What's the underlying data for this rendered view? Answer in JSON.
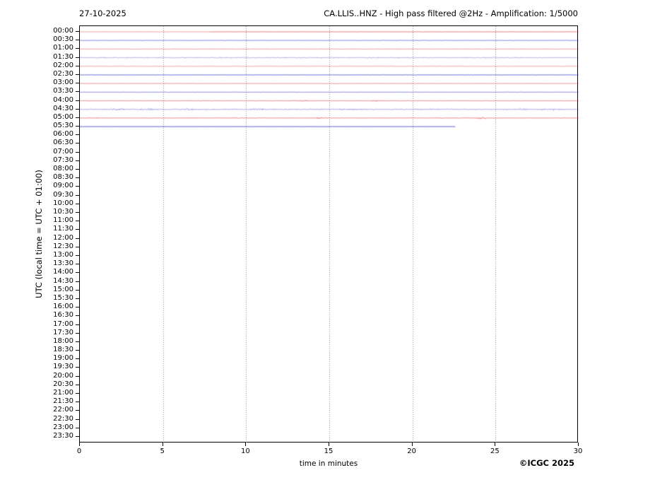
{
  "header": {
    "date": "27-10-2025",
    "title": "CA.LLIS..HNZ - High pass filtered @2Hz - Amplification: 1/5000"
  },
  "footer": {
    "copyright": "©ICGC 2025"
  },
  "chart_data": {
    "type": "line",
    "variant": "helicorder-seismogram",
    "title": "CA.LLIS..HNZ - High pass filtered @2Hz - Amplification: 1/5000",
    "date": "27-10-2025",
    "station": "CA.LLIS..HNZ",
    "filter": "High pass filtered @2Hz",
    "amplification": "1/5000",
    "xlabel": "time in minutes",
    "ylabel": "UTC (local time = UTC + 01:00)",
    "xlim": [
      0,
      30
    ],
    "x_ticks": [
      0,
      5,
      10,
      15,
      20,
      25,
      30
    ],
    "grid": "vertical-dotted",
    "legend": "none",
    "row_labels": [
      "00:00",
      "00:30",
      "01:00",
      "01:30",
      "02:00",
      "02:30",
      "03:00",
      "03:30",
      "04:00",
      "04:30",
      "05:00",
      "05:30",
      "06:00",
      "06:30",
      "07:00",
      "07:30",
      "08:00",
      "08:30",
      "09:00",
      "09:30",
      "10:00",
      "10:30",
      "11:00",
      "11:30",
      "12:00",
      "12:30",
      "13:00",
      "13:30",
      "14:00",
      "14:30",
      "15:00",
      "15:30",
      "16:00",
      "16:30",
      "17:00",
      "17:30",
      "18:00",
      "18:30",
      "19:00",
      "19:30",
      "20:00",
      "20:30",
      "21:00",
      "21:30",
      "22:00",
      "22:30",
      "23:00",
      "23:30"
    ],
    "colors": {
      "red": "#e02828",
      "blue": "#3333cc",
      "grid": "#888888",
      "axes": "#000000"
    },
    "traces": [
      {
        "label": "00:00",
        "color": "red",
        "segments": [
          {
            "s": 0,
            "e": 7.8,
            "amp": 0.15,
            "alpha": 0.4
          },
          {
            "s": 7.8,
            "e": 30,
            "amp": 0.5,
            "alpha": 0.6
          }
        ],
        "events": []
      },
      {
        "label": "00:30",
        "color": "blue",
        "segments": [
          {
            "s": 0,
            "e": 30,
            "amp": 0.5,
            "alpha": 0.6
          }
        ],
        "events": [
          {
            "m": 19.3,
            "a": 0.35,
            "w": 1.6
          }
        ]
      },
      {
        "label": "01:00",
        "color": "red",
        "segments": [
          {
            "s": 0,
            "e": 30,
            "amp": 0.55,
            "alpha": 0.45
          }
        ],
        "events": []
      },
      {
        "label": "01:30",
        "color": "blue",
        "segments": [
          {
            "s": 0,
            "e": 30,
            "amp": 1.2,
            "alpha": 0.35
          }
        ],
        "events": []
      },
      {
        "label": "02:00",
        "color": "red",
        "segments": [
          {
            "s": 0,
            "e": 30,
            "amp": 0.6,
            "alpha": 0.4
          }
        ],
        "events": []
      },
      {
        "label": "02:30",
        "color": "blue",
        "segments": [
          {
            "s": 0,
            "e": 30,
            "amp": 0.45,
            "alpha": 0.7
          }
        ],
        "events": []
      },
      {
        "label": "03:00",
        "color": "red",
        "segments": [
          {
            "s": 0,
            "e": 30,
            "amp": 0.5,
            "alpha": 0.5
          }
        ],
        "events": []
      },
      {
        "label": "03:30",
        "color": "blue",
        "segments": [
          {
            "s": 0,
            "e": 30,
            "amp": 0.55,
            "alpha": 0.55
          }
        ],
        "events": []
      },
      {
        "label": "04:00",
        "color": "red",
        "segments": [
          {
            "s": 0,
            "e": 30,
            "amp": 0.7,
            "alpha": 0.55
          }
        ],
        "events": [
          {
            "m": 13.4,
            "a": 1.1,
            "w": 0.22
          },
          {
            "m": 17.7,
            "a": 1.1,
            "w": 0.22
          }
        ]
      },
      {
        "label": "04:30",
        "color": "blue",
        "segments": [
          {
            "s": 0,
            "e": 30,
            "amp": 1.2,
            "alpha": 0.4
          }
        ],
        "events": [
          {
            "m": 2.4,
            "a": 1.1,
            "w": 0.3
          },
          {
            "m": 4.1,
            "a": 0.9,
            "w": 0.25
          },
          {
            "m": 6.6,
            "a": 1.0,
            "w": 0.3
          },
          {
            "m": 10.7,
            "a": 0.8,
            "w": 0.3
          },
          {
            "m": 16.2,
            "a": 0.7,
            "w": 0.45
          },
          {
            "m": 26.6,
            "a": 1.2,
            "w": 0.2
          },
          {
            "m": 28.5,
            "a": 1.3,
            "w": 0.3
          }
        ]
      },
      {
        "label": "05:00",
        "color": "red",
        "segments": [
          {
            "s": 0,
            "e": 30,
            "amp": 0.6,
            "alpha": 0.55
          }
        ],
        "events": [
          {
            "m": 1.0,
            "a": 0.7,
            "w": 0.2
          },
          {
            "m": 6.7,
            "a": 0.8,
            "w": 0.2
          },
          {
            "m": 9.3,
            "a": 1.0,
            "w": 0.25
          },
          {
            "m": 14.5,
            "a": 1.3,
            "w": 0.25
          },
          {
            "m": 22.8,
            "a": 0.5,
            "w": 1.2
          },
          {
            "m": 24.2,
            "a": 1.7,
            "w": 0.18
          }
        ]
      },
      {
        "label": "05:30",
        "color": "blue",
        "segments": [
          {
            "s": 0,
            "e": 22.6,
            "amp": 0.2,
            "alpha": 0.8
          }
        ],
        "events": []
      }
    ]
  }
}
